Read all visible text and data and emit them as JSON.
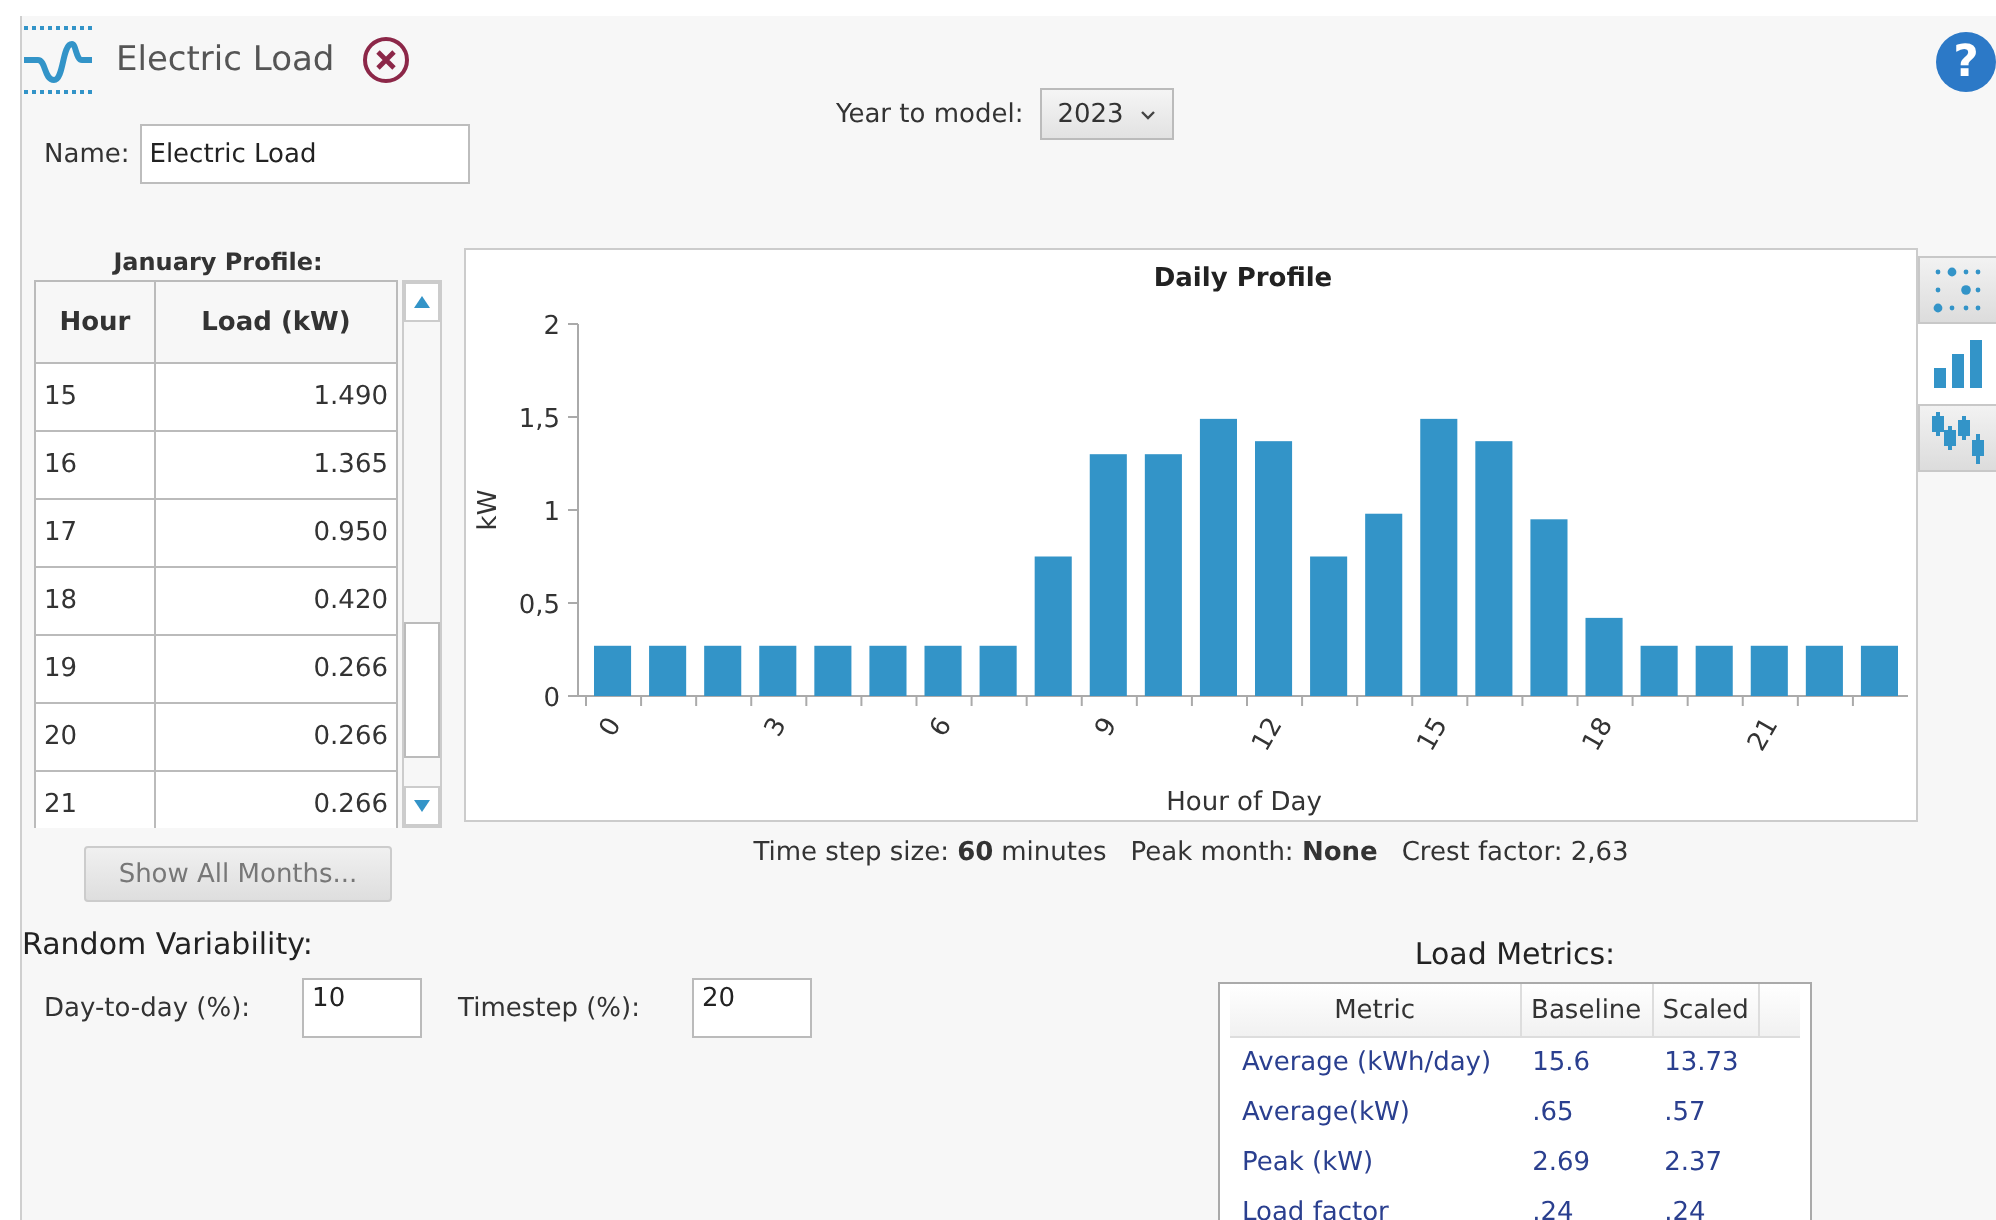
{
  "header": {
    "title": "Electric Load",
    "help": "?"
  },
  "name_field": {
    "label": "Name:",
    "value": "Electric Load"
  },
  "year": {
    "label": "Year to model:",
    "value": "2023"
  },
  "profile": {
    "title": "January Profile:",
    "columns": [
      "Hour",
      "Load (kW)"
    ],
    "rows": [
      {
        "hour": "15",
        "load": "1.490"
      },
      {
        "hour": "16",
        "load": "1.365"
      },
      {
        "hour": "17",
        "load": "0.950"
      },
      {
        "hour": "18",
        "load": "0.420"
      },
      {
        "hour": "19",
        "load": "0.266"
      },
      {
        "hour": "20",
        "load": "0.266"
      },
      {
        "hour": "21",
        "load": "0.266"
      }
    ],
    "button": "Show All Months..."
  },
  "chart": {
    "chart_data": {
      "type": "bar",
      "title": "Daily Profile",
      "xlabel": "Hour of Day",
      "ylabel": "kW",
      "categories": [
        "0",
        null,
        null,
        "3",
        null,
        null,
        "6",
        null,
        null,
        "9",
        null,
        null,
        "12",
        null,
        null,
        "15",
        null,
        null,
        "18",
        null,
        null,
        "21",
        null,
        null
      ],
      "series": [
        {
          "color": "#3394c8",
          "values": [
            0.27,
            0.27,
            0.27,
            0.27,
            0.27,
            0.27,
            0.27,
            0.27,
            0.75,
            1.3,
            1.3,
            1.49,
            1.37,
            0.75,
            0.98,
            1.49,
            1.37,
            0.95,
            0.42,
            0.27,
            0.27,
            0.27,
            0.27,
            0.27
          ]
        }
      ],
      "ylim": [
        0,
        2
      ],
      "yticks": [
        {
          "value": 0,
          "label": "0"
        },
        {
          "value": 0.5,
          "label": "0,5"
        },
        {
          "value": 1,
          "label": "1"
        },
        {
          "value": 1.5,
          "label": "1,5"
        },
        {
          "value": 2,
          "label": "2"
        }
      ]
    },
    "views": [
      {
        "kind": "scatter",
        "selected": false
      },
      {
        "kind": "bar",
        "selected": true
      },
      {
        "kind": "boxplot",
        "selected": false
      }
    ],
    "summary": [
      {
        "label": "Time step size:",
        "value": "60",
        "unit": "minutes"
      },
      {
        "label": "Peak month:",
        "value": "None"
      }
    ],
    "crest": "Crest factor: 2,63"
  },
  "variability": {
    "title": "Random Variability:",
    "fields": [
      {
        "label": "Day-to-day (%):",
        "value": "10"
      },
      {
        "label": "Timestep (%):",
        "value": "20"
      }
    ]
  },
  "metrics": {
    "title": "Load Metrics:",
    "columns": [
      "Metric",
      "Baseline",
      "Scaled"
    ],
    "rows": [
      [
        "Average (kWh/day)",
        "15.6",
        "13.73"
      ],
      [
        "Average(kW)",
        ".65",
        ".57"
      ],
      [
        "Peak (kW)",
        "2.69",
        "2.37"
      ],
      [
        "Load factor",
        ".24",
        ".24"
      ]
    ]
  }
}
